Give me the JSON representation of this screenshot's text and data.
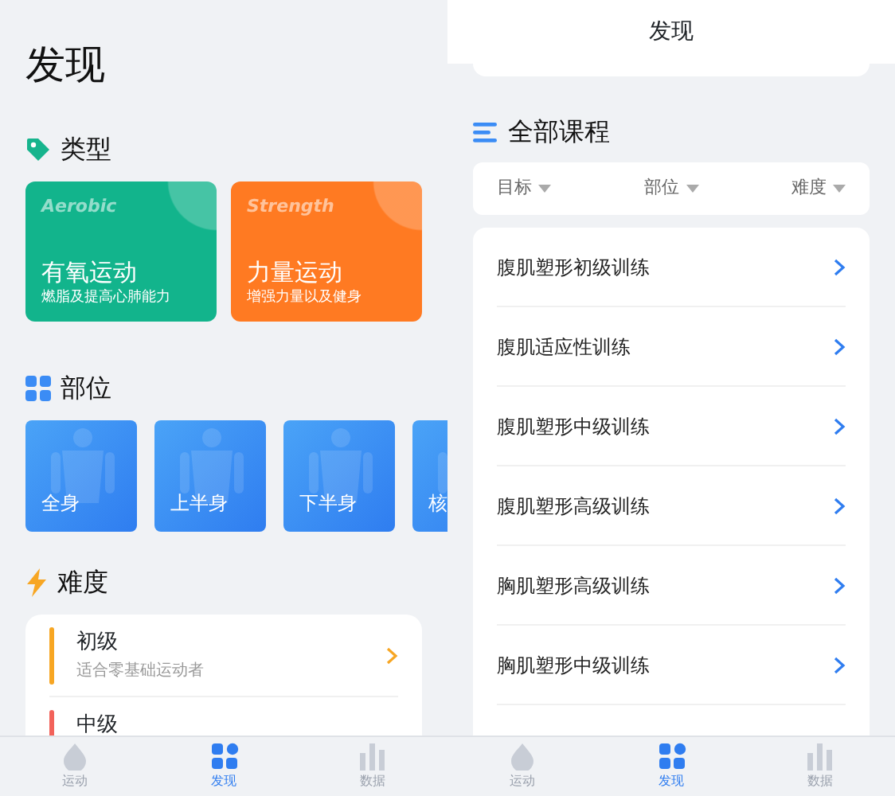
{
  "left": {
    "title": "发现",
    "types": {
      "heading": "类型",
      "cards": [
        {
          "tag": "Aerobic",
          "title": "有氧运动",
          "subtitle": "燃脂及提高心肺能力",
          "color": "#12b48c"
        },
        {
          "tag": "Strength",
          "title": "力量运动",
          "subtitle": "增强力量以及健身",
          "color": "#ff7a22"
        }
      ]
    },
    "parts": {
      "heading": "部位",
      "tiles": [
        "全身",
        "上半身",
        "下半身",
        "核"
      ]
    },
    "levels": {
      "heading": "难度",
      "items": [
        {
          "title": "初级",
          "subtitle": "适合零基础运动者",
          "color": "#f7a623"
        },
        {
          "title": "中级",
          "color": "#f2625a"
        }
      ]
    },
    "tabbar": [
      {
        "label": "运动",
        "selected": false
      },
      {
        "label": "发现",
        "selected": true
      },
      {
        "label": "数据",
        "selected": false
      }
    ]
  },
  "right": {
    "header": "发现",
    "heading": "全部课程",
    "filters": [
      "目标",
      "部位",
      "难度"
    ],
    "courses": [
      "腹肌塑形初级训练",
      "腹肌适应性训练",
      "腹肌塑形中级训练",
      "腹肌塑形高级训练",
      "胸肌塑形高级训练",
      "胸肌塑形中级训练"
    ],
    "tabbar": [
      {
        "label": "运动",
        "selected": false
      },
      {
        "label": "发现",
        "selected": true
      },
      {
        "label": "数据",
        "selected": false
      }
    ]
  }
}
